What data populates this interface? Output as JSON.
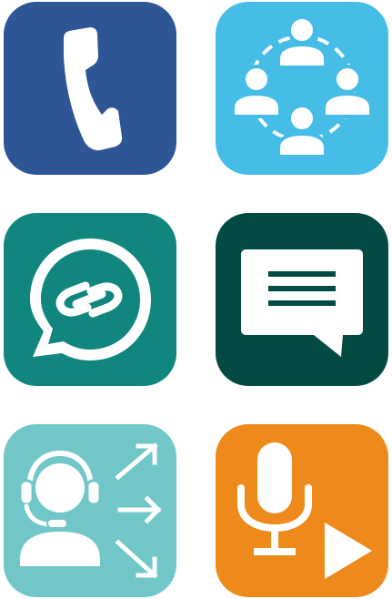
{
  "tiles": [
    {
      "id": "phone-call",
      "icon": "phone-handset-icon",
      "color": "#2E5596"
    },
    {
      "id": "group-network",
      "icon": "people-network-icon",
      "color": "#45BDE6"
    },
    {
      "id": "chat-link",
      "icon": "chat-link-icon",
      "color": "#11867E"
    },
    {
      "id": "text-message",
      "icon": "message-lines-icon",
      "color": "#034A43"
    },
    {
      "id": "call-distribution",
      "icon": "headset-agent-arrows-icon",
      "color": "#71C7C8"
    },
    {
      "id": "voice-playback",
      "icon": "microphone-play-icon",
      "color": "#EE8A1B"
    }
  ]
}
